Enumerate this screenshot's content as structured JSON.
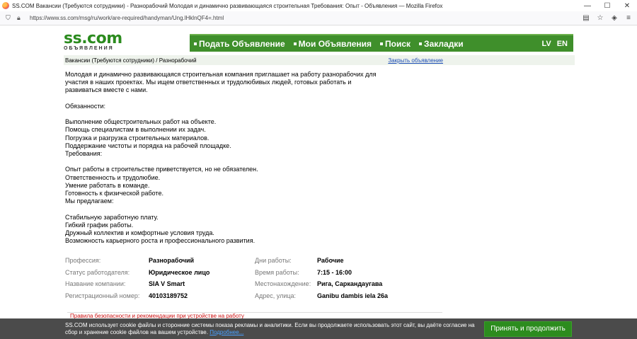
{
  "browser": {
    "window_title": "SS.COM Вакансии (Требуются сотрудники) - Разнорабочий Молодая и динамично развивающаяся строительная Требования: Опыт - Объявления — Mozilla Firefox",
    "url": "https://www.ss.com/msg/ru/work/are-required/handyman/Ung.lHklnQF4=.html"
  },
  "header": {
    "logo_main": "ss.com",
    "logo_sub": "ОБЪЯВЛЕНИЯ",
    "menu": [
      "Подать Объявление",
      "Мои Объявления",
      "Поиск",
      "Закладки"
    ],
    "lang": [
      "LV",
      "EN"
    ]
  },
  "breadcrumb": {
    "text": "Вакансии (Требуются сотрудники) / Разнорабочий",
    "close_link": "Закрыть объявление"
  },
  "description": [
    "Молодая и динамично развивающаяся строительная компания приглашает на работу разнорабочих для",
    "участия в наших проектах. Мы ищем ответственных и трудолюбивых людей, готовых работать и",
    "развиваться вместе с нами.",
    "",
    "Обязанности:",
    "",
    "Выполнение общестроительных работ на объекте.",
    "Помощь специалистам в выполнении их задач.",
    "Погрузка и разгрузка строительных материалов.",
    "Поддержание чистоты и порядка на рабочей площадке.",
    "Требования:",
    "",
    "Опыт работы в строительстве приветствуется, но не обязателен.",
    "Ответственность и трудолюбие.",
    "Умение работать в команде.",
    "Готовность к физической работе.",
    "Мы предлагаем:",
    "",
    "Стабильную заработную плату.",
    "Гибкий график работы.",
    "Дружный коллектив и комфортные условия труда.",
    "Возможность карьерного роста и профессионального развития."
  ],
  "details": [
    {
      "label": "Профессия:",
      "value": "Разнорабочий",
      "label2": "Дни работы:",
      "value2": "Рабочие"
    },
    {
      "label": "Статус работодателя:",
      "value": "Юридическое лицо",
      "label2": "Время работы:",
      "value2": "7:15 - 16:00"
    },
    {
      "label": "Название компании:",
      "value": "SIA V Smart",
      "label2": "Местонахождение:",
      "value2": "Рига, Саркандаугава"
    },
    {
      "label": "Регистрационный номер:",
      "value": "40103189752",
      "label2": "Адрес, улица:",
      "value2": "Ganibu dambis iela 26a"
    }
  ],
  "safety_text": "Правила безопасности и рекомендации при устройстве на работу",
  "cookie": {
    "text": "SS.COM использует cookie файлы и сторонние системы показа рекламы и аналитики. Если вы продолжаете использовать этот сайт, вы даёте согласие на сбор и хранение cookie файлов на вашем устройстве.",
    "more": "Подробнее...",
    "accept": "Принять и продолжить"
  }
}
